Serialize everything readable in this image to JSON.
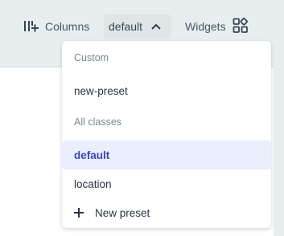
{
  "toolbar": {
    "columns_label": "Columns",
    "preset_value": "default",
    "widgets_label": "Widgets"
  },
  "dropdown": {
    "sections": [
      {
        "heading": "Custom",
        "items": [
          "new-preset"
        ]
      },
      {
        "heading": "All classes",
        "items": [
          "default",
          "location"
        ]
      }
    ],
    "selected_item": "default",
    "new_preset_label": "New preset"
  },
  "colors": {
    "background": "#e6eeef",
    "selected_bg": "#e9effc",
    "selected_text": "#3a45b8"
  }
}
